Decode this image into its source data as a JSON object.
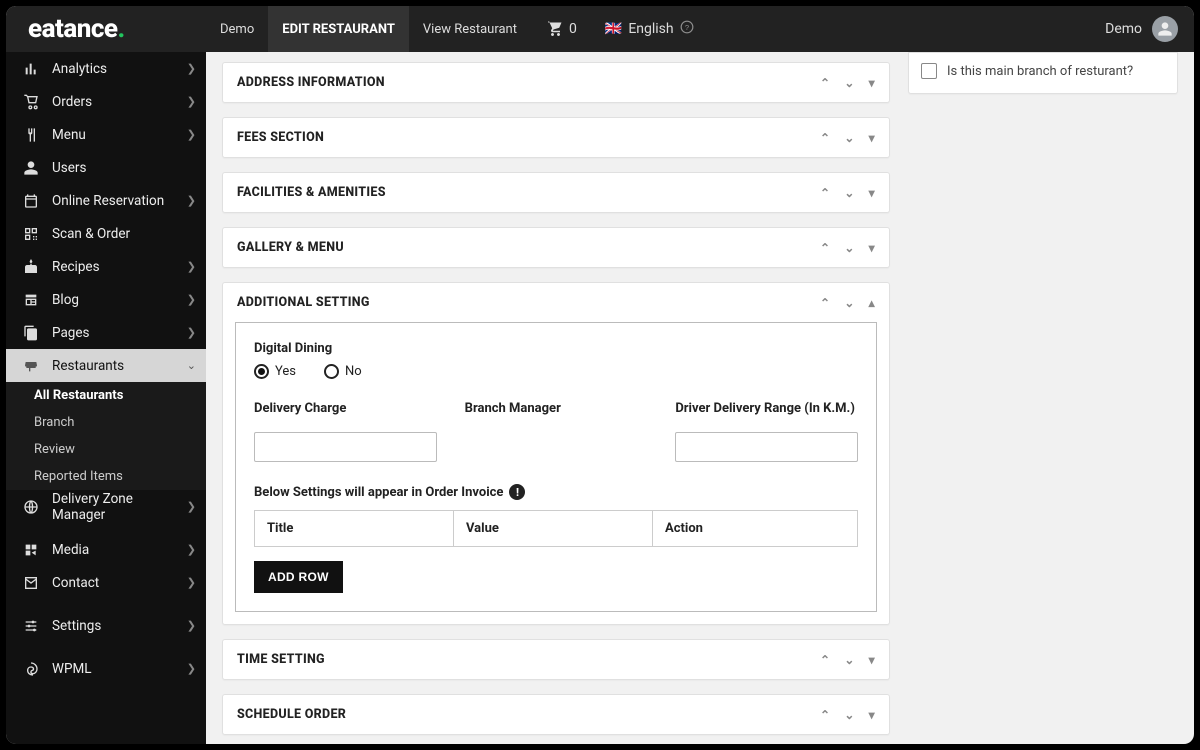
{
  "brand": {
    "name": "eatance",
    "dot": "."
  },
  "topnav": {
    "demo": "Demo",
    "edit": "EDIT RESTAURANT",
    "view": "View Restaurant",
    "cart_count": "0",
    "lang": "English",
    "user": "Demo"
  },
  "sidebar": {
    "items": [
      {
        "key": "analytics",
        "label": "Analytics",
        "chev": true
      },
      {
        "key": "orders",
        "label": "Orders",
        "chev": true
      },
      {
        "key": "menu",
        "label": "Menu",
        "chev": true
      },
      {
        "key": "users",
        "label": "Users",
        "chev": false
      },
      {
        "key": "reservation",
        "label": "Online Reservation",
        "chev": true
      },
      {
        "key": "scan",
        "label": "Scan & Order",
        "chev": false
      },
      {
        "key": "recipes",
        "label": "Recipes",
        "chev": true
      },
      {
        "key": "blog",
        "label": "Blog",
        "chev": true
      },
      {
        "key": "pages",
        "label": "Pages",
        "chev": true
      }
    ],
    "restaurants": {
      "label": "Restaurants",
      "sub": {
        "all": "All Restaurants",
        "branch": "Branch",
        "review": "Review",
        "reported": "Reported Items"
      }
    },
    "below": [
      {
        "key": "delivery_zone",
        "label": "Delivery Zone Manager",
        "chev": true
      },
      {
        "key": "media",
        "label": "Media",
        "chev": true
      },
      {
        "key": "contact",
        "label": "Contact",
        "chev": true
      },
      {
        "key": "settings",
        "label": "Settings",
        "chev": true
      },
      {
        "key": "wpml",
        "label": "WPML",
        "chev": true
      }
    ]
  },
  "right_box": {
    "checkbox_label": "Is this main branch of resturant?"
  },
  "panels": {
    "address": "ADDRESS INFORMATION",
    "fees": "FEES SECTION",
    "facilities": "FACILITIES & AMENITIES",
    "gallery": "GALLERY & MENU",
    "additional": "ADDITIONAL SETTING",
    "time": "TIME SETTING",
    "schedule": "SCHEDULE ORDER"
  },
  "additional": {
    "digital_dining_label": "Digital Dining",
    "radio_yes": "Yes",
    "radio_no": "No",
    "delivery_charge_label": "Delivery Charge",
    "branch_manager_label": "Branch Manager",
    "driver_range_label": "Driver Delivery Range (In K.M.)",
    "invoice_note": "Below Settings will appear in Order Invoice",
    "table": {
      "title": "Title",
      "value": "Value",
      "action": "Action"
    },
    "add_row": "ADD ROW"
  }
}
